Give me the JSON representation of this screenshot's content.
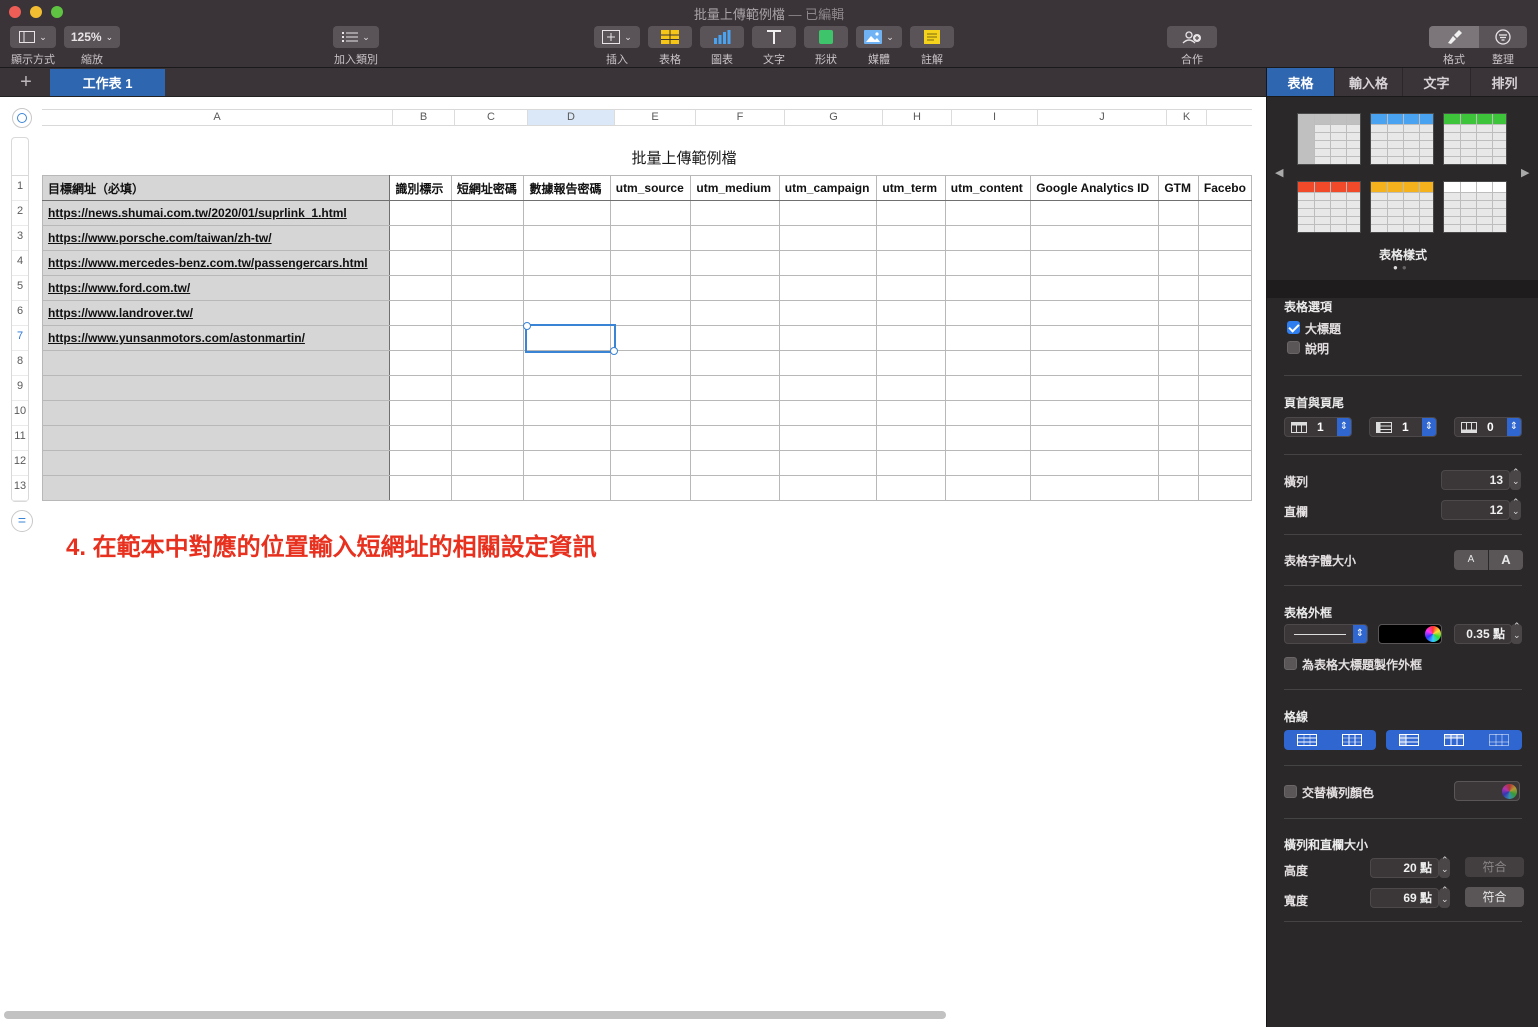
{
  "window": {
    "title": "批量上傳範例檔",
    "edited_suffix": "— 已編輯"
  },
  "toolbar": {
    "view_label": "顯示方式",
    "zoom_value": "125%",
    "zoom_label": "縮放",
    "add_category_label": "加入類別",
    "insert_label": "插入",
    "table_label": "表格",
    "chart_label": "圖表",
    "text_label": "文字",
    "shape_label": "形狀",
    "media_label": "媒體",
    "comment_label": "註解",
    "collaborate_label": "合作",
    "format_label": "格式",
    "organize_label": "整理"
  },
  "sheet_tabs": {
    "add_symbol": "+",
    "active": "工作表 1"
  },
  "sheet": {
    "title": "批量上傳範例檔",
    "column_letters": [
      "A",
      "B",
      "C",
      "D",
      "E",
      "F",
      "G",
      "H",
      "I",
      "J",
      "K",
      ""
    ],
    "selected_column": "D",
    "row_numbers": [
      "1",
      "2",
      "3",
      "4",
      "5",
      "6",
      "7",
      "8",
      "9",
      "10",
      "11",
      "12",
      "13"
    ],
    "selected_row": "7",
    "header_row": [
      "目標網址（必填）",
      "識別標示",
      "短網址密碼",
      "數據報告密碼",
      "utm_source",
      "utm_medium",
      "utm_campaign",
      "utm_term",
      "utm_content",
      "Google Analytics ID",
      "GTM",
      "Facebo"
    ],
    "urls": [
      "https://news.shumai.com.tw/2020/01/suprlink_1.html",
      "https://www.porsche.com/taiwan/zh-tw/",
      "https://www.mercedes-benz.com.tw/passengercars.html",
      "https://www.ford.com.tw/",
      "https://www.landrover.tw/",
      "https://www.yunsanmotors.com/astonmartin/"
    ],
    "annotation": "4. 在範本中對應的位置輸入短網址的相關設定資訊"
  },
  "inspector": {
    "tabs": [
      "表格",
      "輸入格",
      "文字",
      "排列"
    ],
    "active_tab": "表格",
    "table_styles_label": "表格樣式",
    "table_options_label": "表格選項",
    "option_title": "大標題",
    "option_title_checked": true,
    "option_caption": "說明",
    "option_caption_checked": false,
    "headers_footers_label": "頁首與頁尾",
    "header_rows": "1",
    "header_cols": "1",
    "footer_rows": "0",
    "rows_label": "橫列",
    "rows_value": "13",
    "cols_label": "直欄",
    "cols_value": "12",
    "font_size_label": "表格字體大小",
    "font_small": "A",
    "font_large": "A",
    "outline_label": "表格外框",
    "outline_width": "0.35 點",
    "outline_title_label": "為表格大標題製作外框",
    "gridlines_label": "格線",
    "alt_row_label": "交替橫列顏色",
    "size_label": "橫列和直欄大小",
    "height_label": "高度",
    "height_value": "20 點",
    "width_label": "寬度",
    "width_value": "69 點",
    "fit_label": "符合",
    "style_header_colors": [
      "#c0c0c0",
      "#4aa3f0",
      "#3ec43a",
      "#f04a2a",
      "#f5b21c",
      "#ffffff"
    ]
  }
}
